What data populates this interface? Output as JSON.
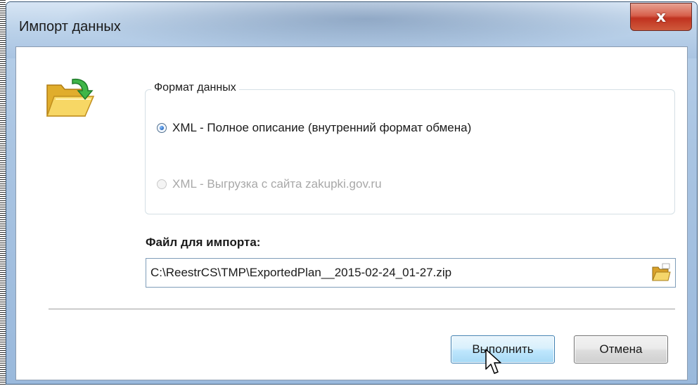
{
  "window": {
    "title": "Импорт данных",
    "close_glyph": "x"
  },
  "icons": {
    "main": "folder-open-import-icon",
    "browse": "folder-browse-icon",
    "close": "close-icon",
    "cursor": "mouse-pointer-icon"
  },
  "format_group": {
    "legend": "Формат данных",
    "options": [
      {
        "label": "XML - Полное описание (внутренний формат обмена)",
        "selected": true,
        "enabled": true
      },
      {
        "label": "XML - Выгрузка с сайта zakupki.gov.ru",
        "selected": false,
        "enabled": false
      }
    ]
  },
  "file": {
    "label": "Файл для импорта:",
    "path": "C:\\ReestrCS\\TMP\\ExportedPlan__2015-02-24_01-27.zip"
  },
  "buttons": {
    "run": "Выполнить",
    "cancel": "Отмена"
  },
  "colors": {
    "close_button": "#c0321f",
    "title_bar": "#bdd3ea",
    "default_button": "#bee6fd"
  }
}
